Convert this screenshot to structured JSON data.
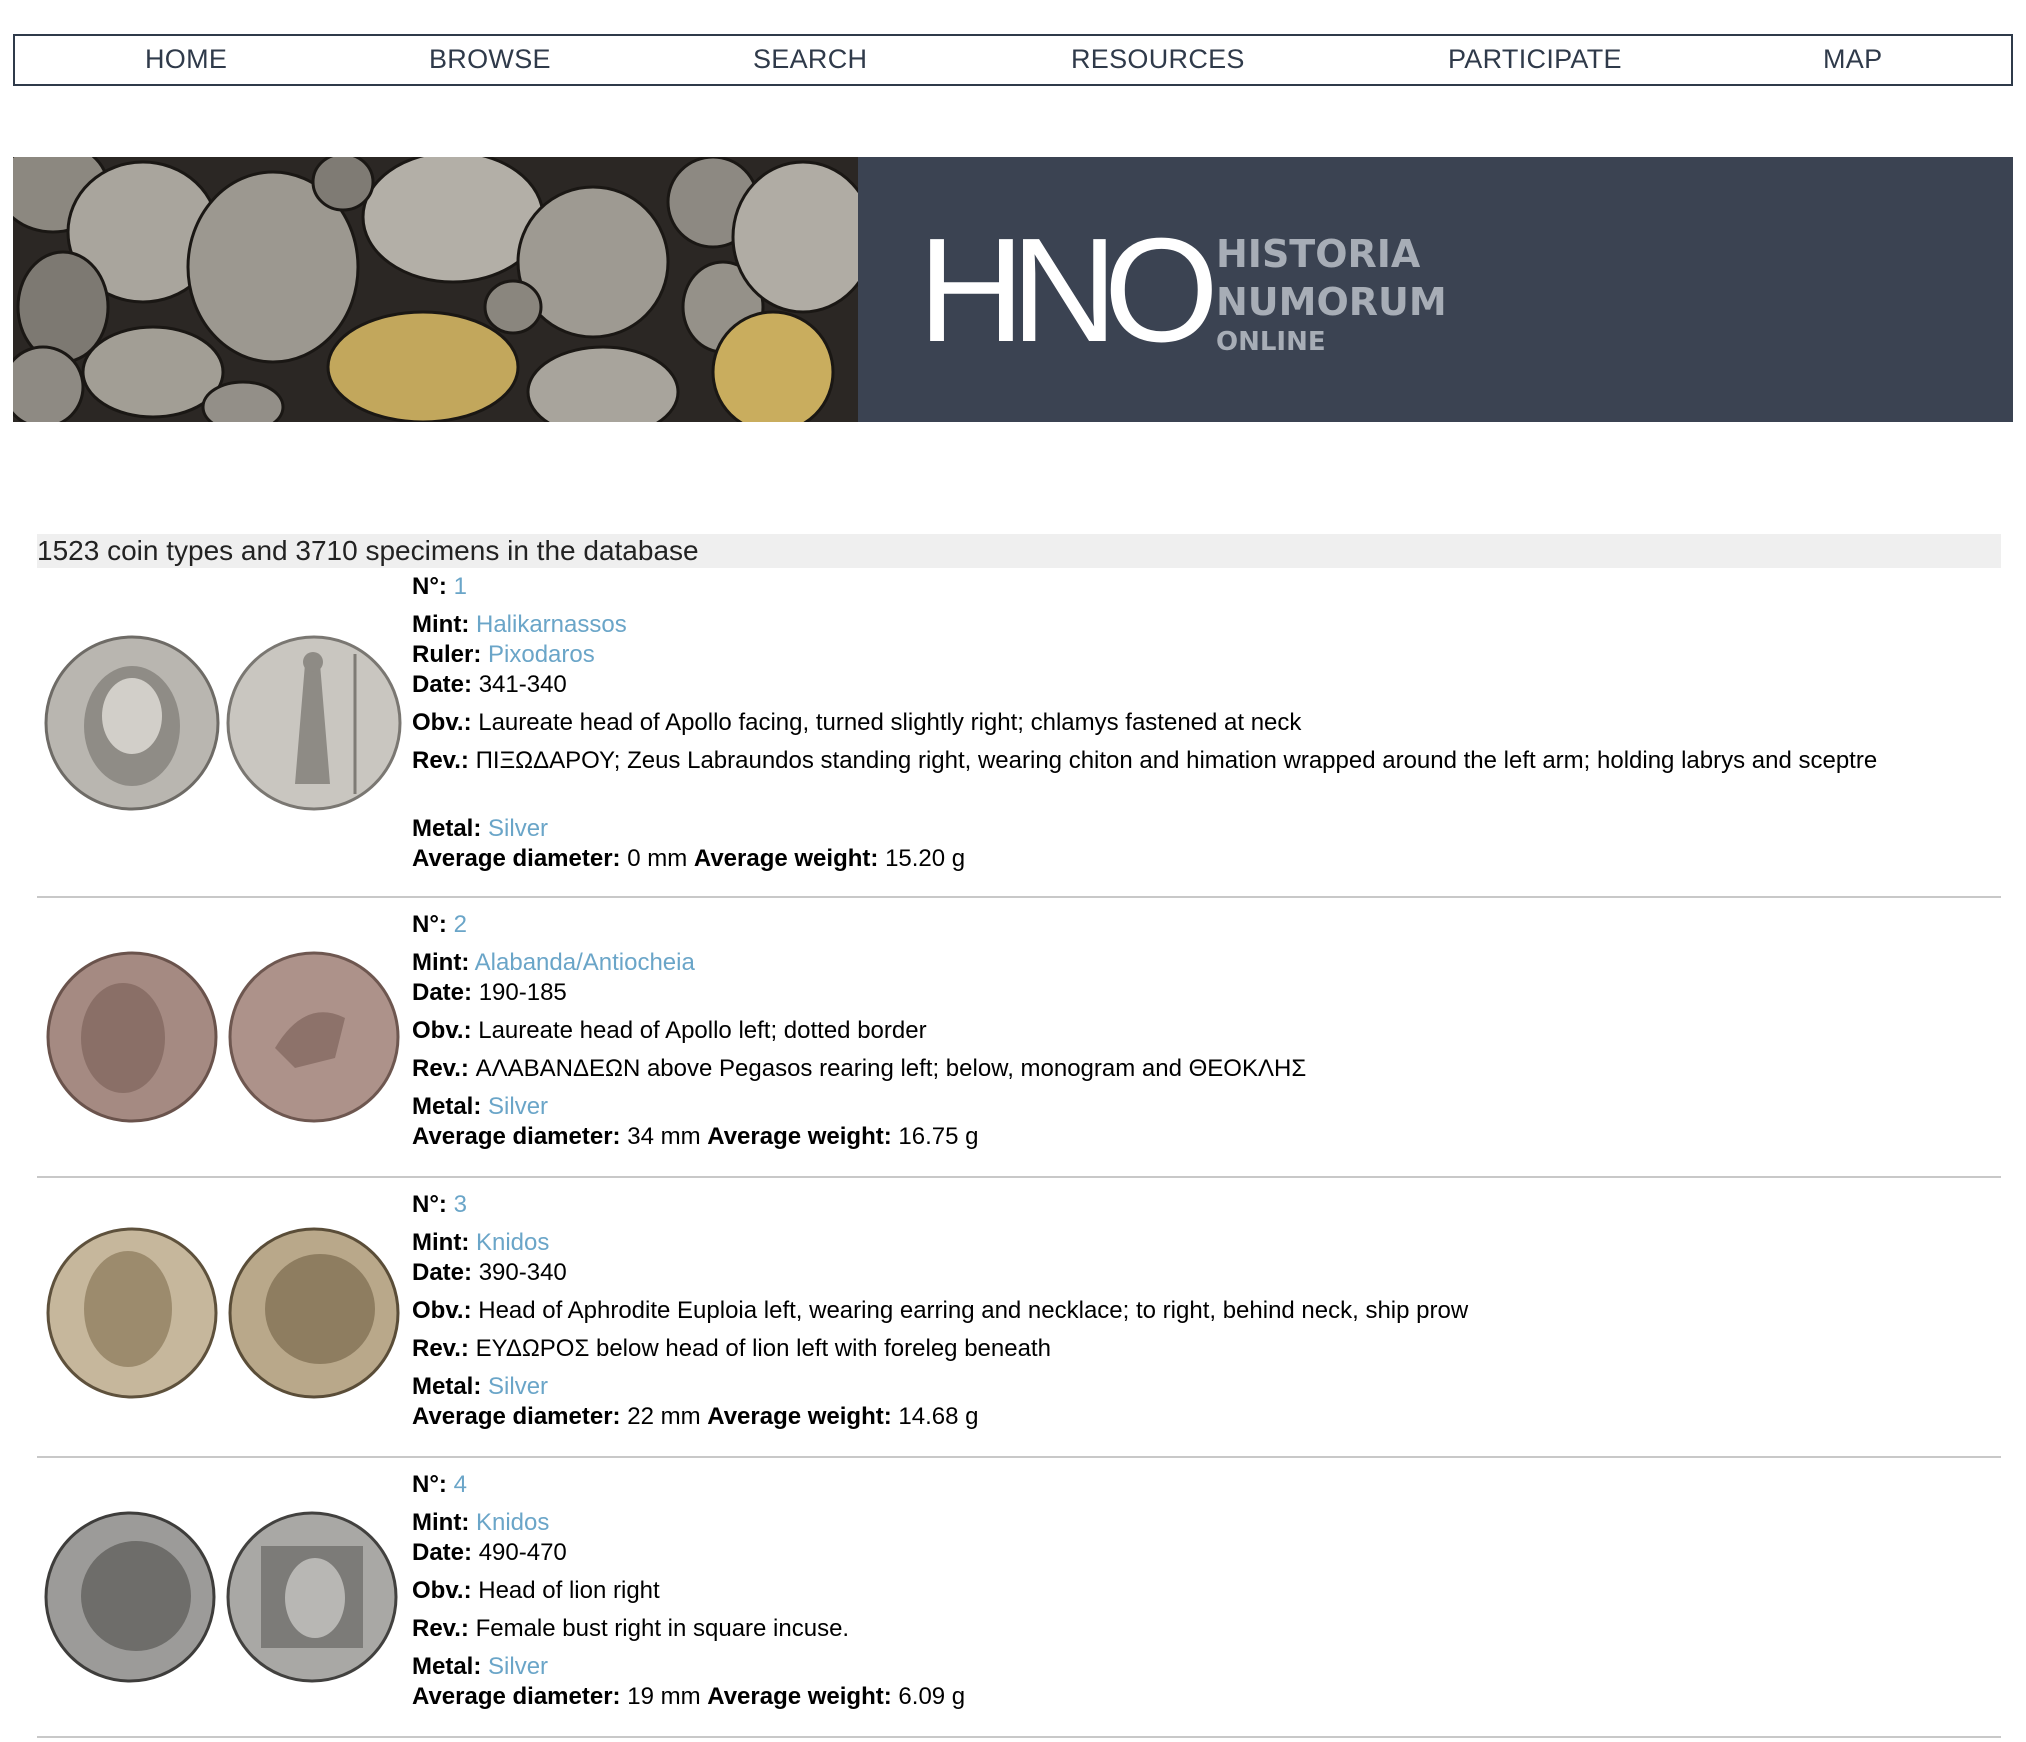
{
  "nav": {
    "items": [
      {
        "label": "HOME"
      },
      {
        "label": "BROWSE"
      },
      {
        "label": "SEARCH"
      },
      {
        "label": "RESOURCES"
      },
      {
        "label": "PARTICIPATE"
      },
      {
        "label": "MAP"
      }
    ]
  },
  "banner": {
    "logo_letters": "HNO",
    "line1": "HISTORIA",
    "line2": "NUMORUM",
    "line3": "ONLINE"
  },
  "summary": "1523 coin types and 3710 specimens in the database",
  "labels": {
    "no": "N°:",
    "mint": "Mint:",
    "ruler": "Ruler:",
    "date": "Date:",
    "obv": "Obv.:",
    "rev": "Rev.:",
    "metal": "Metal:",
    "diameter": "Average diameter:",
    "weight": "Average weight:"
  },
  "coins": [
    {
      "no": "1",
      "mint": "Halikarnassos",
      "ruler": "Pixodaros",
      "date": "341-340",
      "obv": "Laureate head of Apollo facing, turned slightly right; chlamys fastened at neck",
      "rev": "ΠΙΞΩΔΑΡΟΥ; Zeus Labraundos standing right, wearing chiton and himation wrapped around the left arm; holding labrys and sceptre",
      "metal": "Silver",
      "diameter": "0 mm",
      "weight": "15.20 g"
    },
    {
      "no": "2",
      "mint": "Alabanda/Antiocheia",
      "date": "190-185",
      "obv": "Laureate head of Apollo left; dotted border",
      "rev": "ΑΛΑΒΑΝΔΕΩΝ above Pegasos rearing left; below, monogram and ΘΕΟΚΛΗΣ",
      "metal": "Silver",
      "diameter": "34 mm",
      "weight": "16.75 g"
    },
    {
      "no": "3",
      "mint": "Knidos",
      "date": "390-340",
      "obv": "Head of Aphrodite Euploia left, wearing earring and necklace; to right, behind neck, ship prow",
      "rev": "ΕΥΔΩΡΟΣ below head of lion left with foreleg beneath",
      "metal": "Silver",
      "diameter": "22 mm",
      "weight": "14.68 g"
    },
    {
      "no": "4",
      "mint": "Knidos",
      "date": "490-470",
      "obv": "Head of lion right",
      "rev": "Female bust right in square incuse.",
      "metal": "Silver",
      "diameter": "19 mm",
      "weight": "6.09 g"
    }
  ],
  "colors": {
    "nav_text": "#2f3a4a",
    "banner_bg": "#3b4352",
    "link": "#6aa5c8",
    "summary_bg": "#efefef"
  }
}
